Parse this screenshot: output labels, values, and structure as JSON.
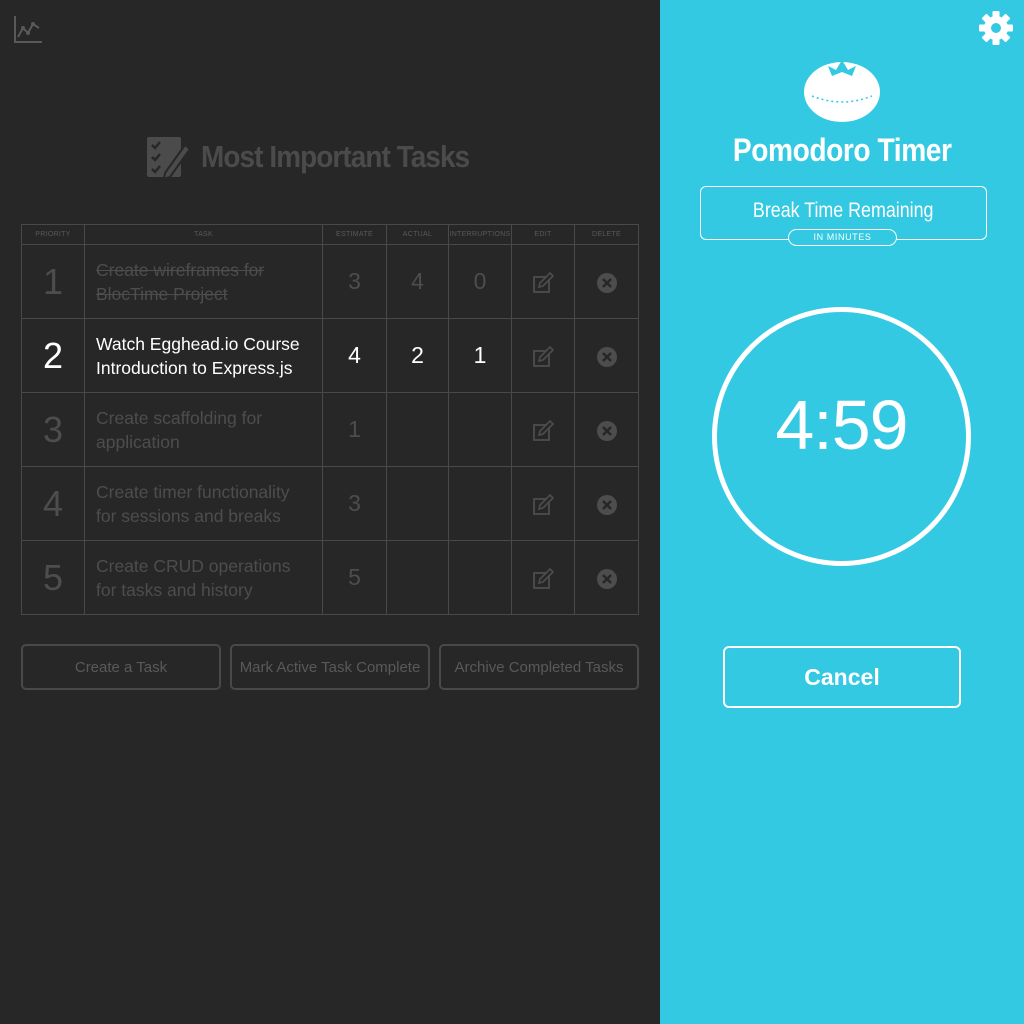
{
  "left_panel": {
    "stats_icon": "line-chart-icon",
    "title": "Most Important Tasks",
    "title_icon": "checklist-pen-icon",
    "table": {
      "headers": [
        "PRIORITY",
        "TASK",
        "ESTIMATE",
        "ACTUAL",
        "INTERRUPTIONS",
        "EDIT",
        "DELETE"
      ],
      "rows": [
        {
          "priority": "1",
          "task": "Create wireframes for BlocTime Project",
          "estimate": "3",
          "actual": "4",
          "interruptions": "0",
          "state": "completed"
        },
        {
          "priority": "2",
          "task": "Watch Egghead.io Course Introduction to Express.js",
          "estimate": "4",
          "actual": "2",
          "interruptions": "1",
          "state": "active"
        },
        {
          "priority": "3",
          "task": "Create scaffolding for application",
          "estimate": "1",
          "actual": "",
          "interruptions": "",
          "state": "pending"
        },
        {
          "priority": "4",
          "task": "Create timer functionality for sessions and breaks",
          "estimate": "3",
          "actual": "",
          "interruptions": "",
          "state": "pending"
        },
        {
          "priority": "5",
          "task": "Create CRUD operations for tasks and history",
          "estimate": "5",
          "actual": "",
          "interruptions": "",
          "state": "pending"
        }
      ],
      "edit_icon": "edit-icon",
      "delete_icon": "delete-x-icon"
    },
    "buttons": {
      "create": "Create a Task",
      "complete": "Mark Active Task Complete",
      "archive": "Archive Completed Tasks"
    }
  },
  "right_panel": {
    "settings_icon": "gear-icon",
    "logo_icon": "tomato-icon",
    "title": "Pomodoro Timer",
    "mode_label": "Break Time Remaining",
    "unit_label": "IN MINUTES",
    "time": "4:59",
    "cancel_label": "Cancel"
  },
  "colors": {
    "left_background": "#282727",
    "right_background": "#33c9e2",
    "muted_text": "#4e4d4d",
    "active_text": "#ffffff"
  }
}
